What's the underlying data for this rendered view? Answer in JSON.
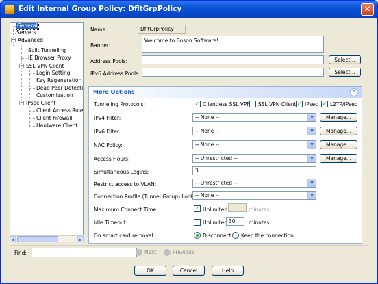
{
  "window": {
    "title": "Edit Internal Group Policy: DfltGrpPolicy",
    "close_glyph": "✕"
  },
  "tree": {
    "items": [
      {
        "label": "General"
      },
      {
        "label": "Servers"
      },
      {
        "label": "Advanced"
      },
      {
        "label": "Split Tunneling"
      },
      {
        "label": "IE Browser Proxy"
      },
      {
        "label": "SSL VPN Client"
      },
      {
        "label": "Login Setting"
      },
      {
        "label": "Key Regeneration"
      },
      {
        "label": "Dead Peer Detection"
      },
      {
        "label": "Customization"
      },
      {
        "label": "IPsec Client"
      },
      {
        "label": "Client Access Rules"
      },
      {
        "label": "Client Firewall"
      },
      {
        "label": "Hardware Client"
      }
    ],
    "expander_minus": "−",
    "scroll_left": "◀",
    "scroll_right": "▶"
  },
  "form": {
    "name_label": "Name:",
    "name_value": "DfltGrpPolicy",
    "banner_label": "Banner:",
    "banner_value": "Welcome to Boson Software!",
    "address_pools_label": "Address Pools:",
    "ipv6_pools_label": "IPv6 Address Pools:",
    "select_label": "Select..."
  },
  "more_options": {
    "title": "More Options",
    "collapse_glyph": "⌃",
    "tunneling_label": "Tunneling Protocols:",
    "protocols": [
      {
        "label": "Clientless SSL VPN",
        "checked": true
      },
      {
        "label": "SSL VPN Client",
        "checked": false
      },
      {
        "label": "IPsec",
        "checked": true
      },
      {
        "label": "L2TP/IPsec",
        "checked": true
      }
    ],
    "check_glyph": "✓",
    "dropdown_glyph": "▼",
    "manage_label": "Manage...",
    "rows": {
      "ipv4_filter": {
        "label": "IPv4 Filter:",
        "value": "-- None --"
      },
      "ipv6_filter": {
        "label": "IPv6 Filter:",
        "value": "-- None --"
      },
      "nac_policy": {
        "label": "NAC Policy:",
        "value": "-- None --"
      },
      "access_hours": {
        "label": "Access Hours:",
        "value": "-- Unrestricted --"
      },
      "sim_logins": {
        "label": "Simultaneous Logins:",
        "value": "3"
      },
      "restrict_vlan": {
        "label": "Restrict access to VLAN:",
        "value": "-- Unrestricted --"
      },
      "conn_profile": {
        "label": "Connection Profile (Tunnel Group) Lock:",
        "value": "-- None --"
      },
      "max_connect": {
        "label": "Maximum Connect Time:",
        "unlimited_label": "Unlimited",
        "unlimited_checked": true,
        "minutes_label": "minutes",
        "minutes_value": ""
      },
      "idle_timeout": {
        "label": "Idle Timeout:",
        "unlimited_label": "Unlimited",
        "unlimited_checked": false,
        "minutes_value": "30",
        "minutes_label": "minutes"
      },
      "smart_card": {
        "label": "On smart card removal:",
        "options": [
          "Disconnect",
          "Keep the connection"
        ],
        "selected": "Disconnect"
      }
    }
  },
  "find": {
    "label": "Find:",
    "value": "",
    "next_label": "Next",
    "previous_label": "Previous"
  },
  "buttons": {
    "ok": "OK",
    "cancel": "Cancel",
    "help": "Help"
  }
}
